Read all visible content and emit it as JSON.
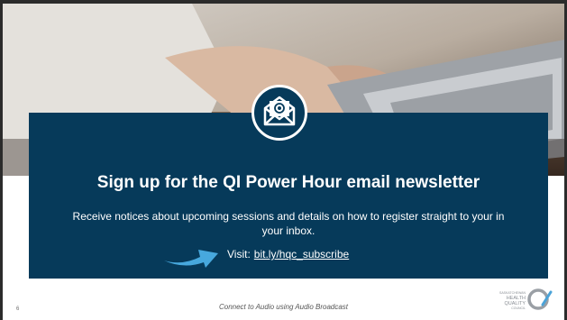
{
  "slide": {
    "headline": "Sign up for the QI Power Hour email newsletter",
    "description": "Receive notices about upcoming sessions and details on how to register straight to your in your inbox.",
    "visit_label": "Visit:",
    "visit_link": "bit.ly/hqc_subscribe",
    "page_number": "6",
    "footer_note": "Connect to Audio using Audio Broadcast",
    "logo_text": [
      "SASKATCHEWAN",
      "HEALTH",
      "QUALITY",
      "COUNCIL"
    ]
  },
  "icons": {
    "email": "envelope-at-icon",
    "arrow": "right-arrow-icon",
    "logo": "hqc-logo"
  },
  "colors": {
    "panel": "#063a5a",
    "arrow": "#47a8dd",
    "text": "#ffffff"
  }
}
